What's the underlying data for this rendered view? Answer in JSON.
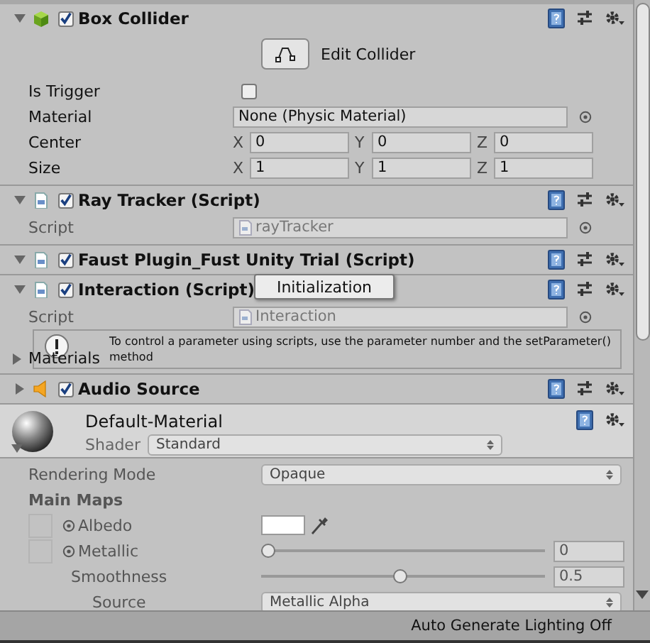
{
  "components": [
    {
      "kind": "collider",
      "title": "Box Collider",
      "enabled": true,
      "expanded": true,
      "edit_button": "Edit Collider",
      "properties": [
        {
          "kind": "toggle",
          "label": "Is Trigger",
          "checked": false
        },
        {
          "kind": "object",
          "label": "Material",
          "value": "None (Physic Material)"
        },
        {
          "kind": "vector",
          "label": "Center",
          "axes": [
            {
              "axis": "X",
              "value": "0"
            },
            {
              "axis": "Y",
              "value": "0"
            },
            {
              "axis": "Z",
              "value": "0"
            }
          ]
        },
        {
          "kind": "vector",
          "label": "Size",
          "axes": [
            {
              "axis": "X",
              "value": "1"
            },
            {
              "axis": "Y",
              "value": "1"
            },
            {
              "axis": "Z",
              "value": "1"
            }
          ]
        }
      ]
    },
    {
      "kind": "script",
      "title": "Ray Tracker (Script)",
      "enabled": true,
      "expanded": true,
      "properties": [
        {
          "kind": "script",
          "label": "Script",
          "value": "rayTracker"
        }
      ]
    },
    {
      "kind": "script",
      "title": "Faust Plugin_Fust Unity Trial (Script)",
      "enabled": true,
      "expanded": true
    },
    {
      "kind": "script",
      "title": "Interaction (Script)",
      "enabled": true,
      "expanded": true,
      "popup": "Initialization",
      "properties": [
        {
          "kind": "script",
          "label": "Script",
          "value": "Interaction"
        }
      ],
      "help": "To control a parameter using scripts, use the parameter number and the setParameter() method",
      "overlay_foldout": "Materials"
    },
    {
      "kind": "audio",
      "title": "Audio Source",
      "enabled": true,
      "expanded": false
    }
  ],
  "material": {
    "name": "Default-Material",
    "shader_label": "Shader",
    "shader": "Standard",
    "expanded": true,
    "properties": [
      {
        "kind": "dropdown",
        "label": "Rendering Mode",
        "value": "Opaque"
      },
      {
        "kind": "heading",
        "label": "Main Maps"
      },
      {
        "kind": "color",
        "label": "Albedo"
      },
      {
        "kind": "slider",
        "label": "Metallic",
        "level": 0,
        "value": "0",
        "children": [
          {
            "kind": "slider",
            "label": "Smoothness",
            "level": 0.5,
            "value": "0.5",
            "children": [
              {
                "kind": "dropdown",
                "label": "Source",
                "value": "Metallic Alpha"
              }
            ]
          }
        ]
      }
    ]
  },
  "status_bar": "Auto Generate Lighting Off"
}
